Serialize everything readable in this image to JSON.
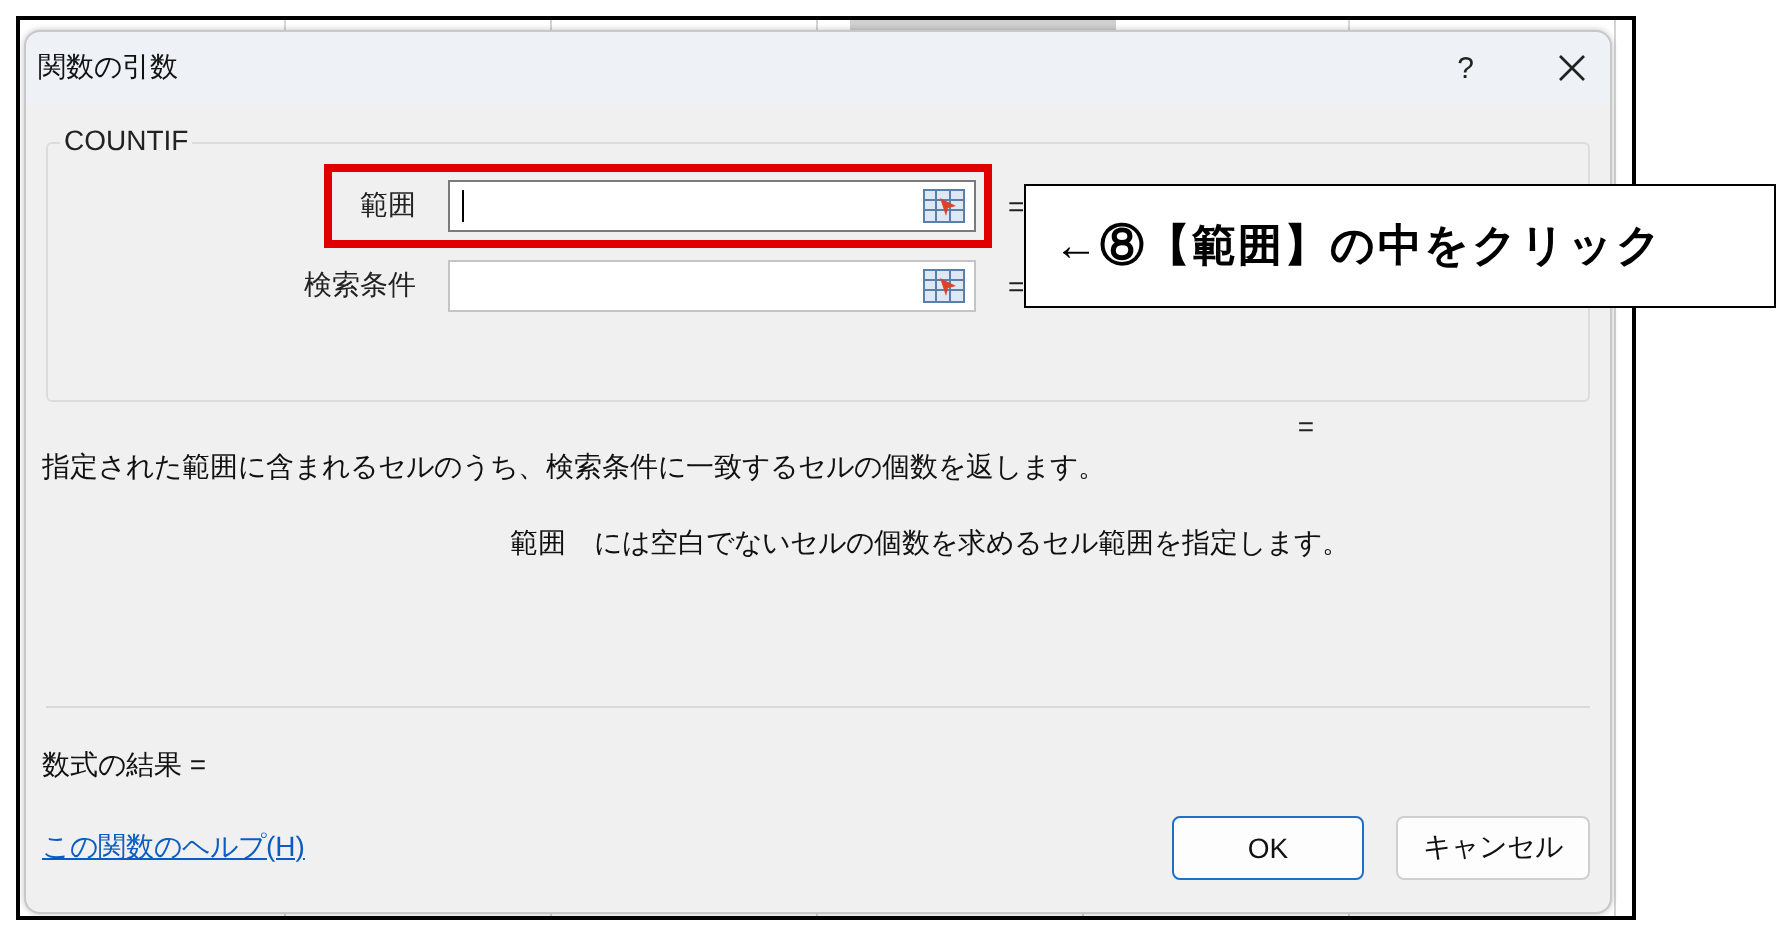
{
  "window": {
    "title": "関数の引数",
    "help": "?"
  },
  "function": {
    "name": "COUNTIF",
    "arguments": [
      {
        "label": "範囲",
        "focused": true,
        "highlighted": true,
        "equals": "="
      },
      {
        "label": "検索条件",
        "focused": false,
        "highlighted": false,
        "equals": "="
      }
    ]
  },
  "result_equals": "=",
  "description": "指定された範囲に含まれるセルのうち、検索条件に一致するセルの個数を返します。",
  "argument_help": {
    "name": "範囲",
    "text": "には空白でないセルの個数を求めるセル範囲を指定します。"
  },
  "formula_result": "数式の結果 =",
  "help_link": "この関数のヘルプ(H)",
  "buttons": [
    {
      "label": "OK",
      "default": true
    },
    {
      "label": "キャンセル",
      "default": false
    }
  ],
  "callout": "←⑧【範囲】の中をクリック"
}
